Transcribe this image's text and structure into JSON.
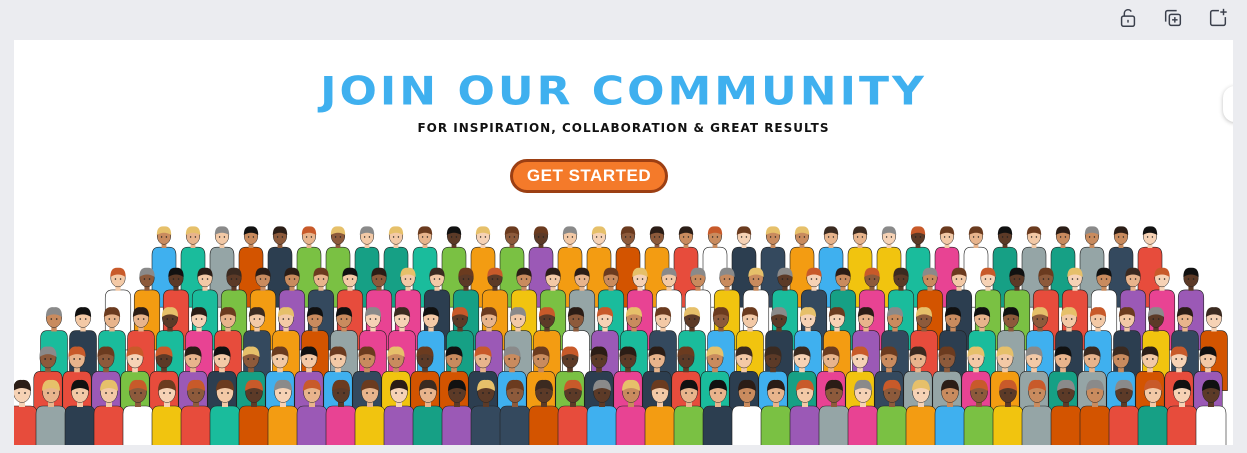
{
  "toolbar": {
    "buttons": [
      {
        "name": "lock-icon",
        "tooltip": ""
      },
      {
        "name": "duplicate-page-icon",
        "tooltip": ""
      },
      {
        "name": "add-page-icon",
        "tooltip": ""
      }
    ]
  },
  "page": {
    "headline": "JOIN OUR COMMUNITY",
    "subheadline": "FOR INSPIRATION, COLLABORATION & GREAT RESULTS",
    "cta_label": "GET STARTED"
  },
  "colors": {
    "background": "#ebecf0",
    "headline": "#3fb0ef",
    "cta_fill": "#f47a2a",
    "cta_border": "#9c3f13"
  }
}
